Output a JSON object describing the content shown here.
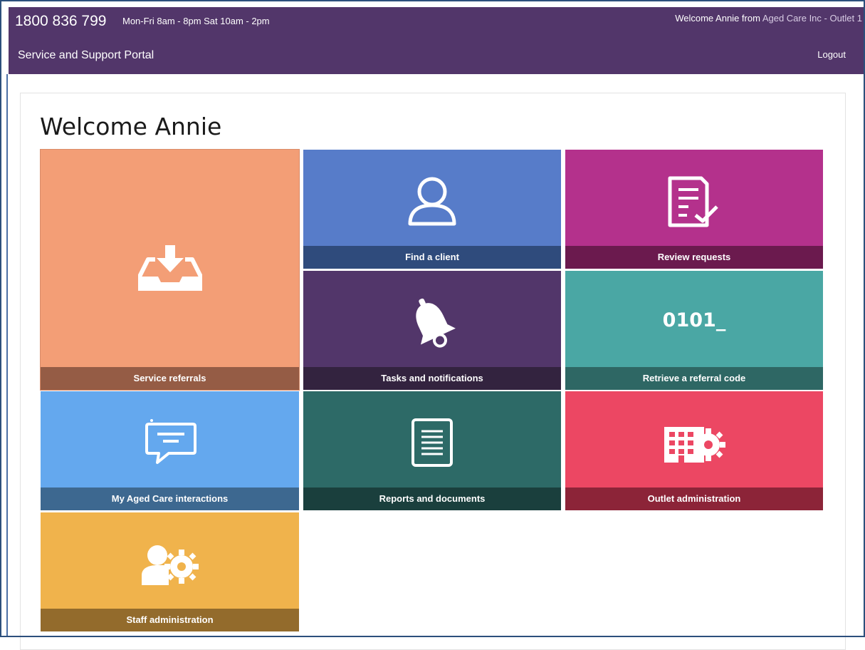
{
  "header": {
    "phone": "1800 836 799",
    "hours": "Mon-Fri 8am - 8pm Sat 10am - 2pm",
    "welcome_prefix": "Welcome Annie from ",
    "welcome_org": "Aged Care Inc - Outlet 1",
    "portal_title": "Service and Support Portal",
    "logout_label": "Logout",
    "bg_color": "#52366a"
  },
  "main": {
    "title": "Welcome Annie"
  },
  "tiles": [
    {
      "label": "Service referrals",
      "icon": "inbox-download-icon",
      "color": "#f39e76"
    },
    {
      "label": "Find a client",
      "icon": "user-icon",
      "color": "#577cc9"
    },
    {
      "label": "Review requests",
      "icon": "document-check-icon",
      "color": "#b4318c"
    },
    {
      "label": "Tasks and notifications",
      "icon": "bell-icon",
      "color": "#52366a"
    },
    {
      "label": "Retrieve a referral code",
      "icon": "code-icon",
      "code_text": "0101_",
      "color": "#4aa7a4"
    },
    {
      "label": "My Aged Care interactions",
      "icon": "chat-bubble-icon",
      "color": "#64a8ee"
    },
    {
      "label": "Reports and documents",
      "icon": "report-document-icon",
      "color": "#2d6a67"
    },
    {
      "label": "Outlet administration",
      "icon": "building-gear-icon",
      "color": "#ec4763"
    },
    {
      "label": "Staff administration",
      "icon": "user-gear-icon",
      "color": "#f0b34c"
    }
  ]
}
